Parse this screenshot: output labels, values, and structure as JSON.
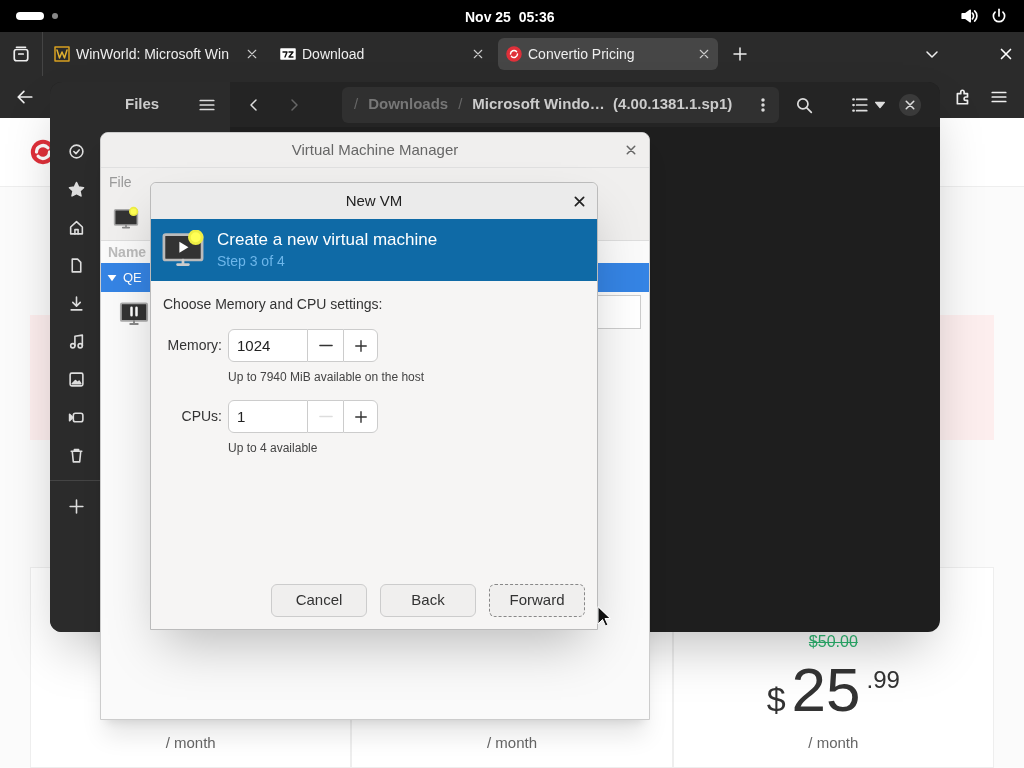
{
  "top_bar": {
    "clock": "Nov 25  05:36"
  },
  "browser": {
    "tabs": [
      {
        "label": "WinWorld: Microsoft Win",
        "kind": "winworld",
        "selected": false
      },
      {
        "label": "Download",
        "kind": "archive",
        "selected": false
      },
      {
        "label": "Convertio Pricing",
        "kind": "convertio",
        "selected": true
      }
    ],
    "page": {
      "plans": [
        {
          "period": "/ month"
        },
        {
          "period": "/ month"
        },
        {
          "old_price": "$50.00",
          "currency": "$",
          "amount": "25",
          "cents": ".99",
          "period": "/ month"
        }
      ]
    }
  },
  "files": {
    "title": "Files",
    "path": {
      "separator": "/",
      "segments": [
        {
          "label": "Downloads",
          "selected": false
        },
        {
          "label": "Microsoft Windo…  (4.00.1381.1.sp1)",
          "selected": true
        }
      ]
    },
    "sidebar": [
      {
        "kind": "recent"
      },
      {
        "kind": "starred"
      },
      {
        "kind": "home"
      },
      {
        "kind": "documents"
      },
      {
        "kind": "downloads"
      },
      {
        "kind": "music"
      },
      {
        "kind": "pictures"
      },
      {
        "kind": "videos"
      },
      {
        "kind": "trash"
      },
      {
        "kind": "other"
      }
    ]
  },
  "vm_manager": {
    "title": "Virtual Machine Manager",
    "menu": [
      "File"
    ],
    "column": "Name",
    "rows": [
      {
        "label": "QE",
        "selected": true
      }
    ]
  },
  "new_vm": {
    "title": "New VM",
    "heading": "Create a new virtual machine",
    "step": "Step 3 of 4",
    "prompt": "Choose Memory and CPU settings:",
    "fields": [
      {
        "label": "Memory:",
        "value": "1024",
        "hint": "Up to 7940 MiB available on the host",
        "decrement_disabled": false
      },
      {
        "label": "CPUs:",
        "value": "1",
        "hint": "Up to 4 available",
        "decrement_disabled": true
      }
    ],
    "buttons": [
      {
        "label": "Cancel",
        "focused": false
      },
      {
        "label": "Back",
        "focused": false
      },
      {
        "label": "Forward",
        "focused": true
      }
    ]
  }
}
